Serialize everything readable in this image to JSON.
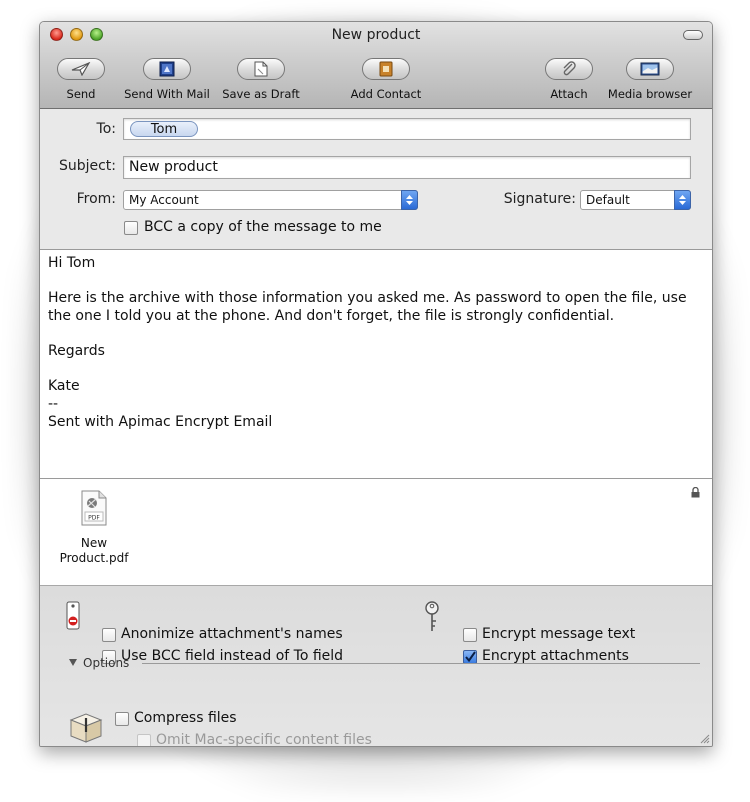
{
  "window": {
    "title": "New product"
  },
  "toolbar": {
    "send": "Send",
    "send_with_mail": "Send With Mail",
    "save_as_draft": "Save as Draft",
    "add_contact": "Add Contact",
    "attach": "Attach",
    "media_browser": "Media browser"
  },
  "header": {
    "to_label": "To:",
    "to_token": "Tom",
    "subject_label": "Subject:",
    "subject_value": "New product",
    "from_label": "From:",
    "from_value": "My Account",
    "signature_label": "Signature:",
    "signature_value": "Default",
    "bcc_copy_label": "BCC a copy of the message to me"
  },
  "message": {
    "lines": [
      "Hi Tom",
      "",
      "Here is the archive with those information you asked me. As password to open the file, use the one I told you at the phone. And don't forget, the file is strongly confidential.",
      "",
      "Regards",
      "",
      "Kate",
      "--",
      "Sent with Apimac Encrypt Email"
    ]
  },
  "attachment": {
    "name_line1": "New",
    "name_line2": "Product.pdf",
    "icon_text": "PDF"
  },
  "options": {
    "anonimize": "Anonimize attachment's names",
    "use_bcc": "Use BCC field instead of To field",
    "encrypt_text": "Encrypt message text",
    "encrypt_attachments": "Encrypt attachments",
    "encrypt_attachments_checked": true,
    "section_title": "Options",
    "compress": "Compress files",
    "omit_mac": "Omit Mac-specific content files"
  },
  "colors": {
    "accent_blue": "#3a7ce0",
    "close": "#d9281c",
    "minimize": "#e09a12",
    "zoom": "#4ea52a"
  }
}
